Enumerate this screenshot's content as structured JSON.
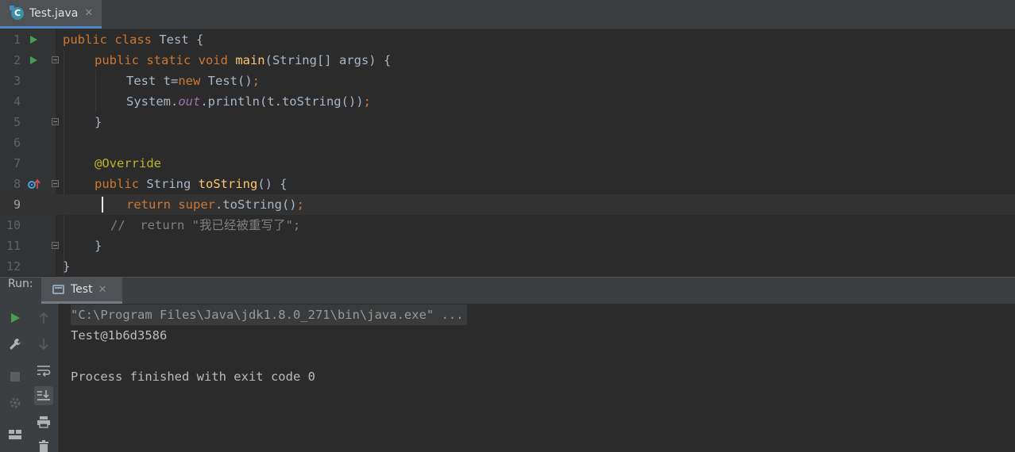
{
  "editor_tab": {
    "label": "Test.java",
    "close": "✕",
    "icon_letter": "C"
  },
  "code_lines": {
    "n1": "1",
    "n2": "2",
    "n3": "3",
    "n4": "4",
    "n5": "5",
    "n6": "6",
    "n7": "7",
    "n8": "8",
    "n9": "9",
    "n10": "10",
    "n11": "11",
    "n12": "12",
    "l1": {
      "kw": "public class ",
      "name": "Test",
      "rest": " {"
    },
    "l2": {
      "kw": "public static void ",
      "fn": "main",
      "rest": "(String[] args) {"
    },
    "l3": {
      "a": "Test t=",
      "kw": "new ",
      "b": "Test()",
      "semi": ";"
    },
    "l4": {
      "a": "System.",
      "fld": "out",
      "b": ".println(t.toString())",
      "semi": ";"
    },
    "l5": {
      "a": "}"
    },
    "l7": {
      "ann": "@Override"
    },
    "l8": {
      "kw": "public ",
      "a": "String ",
      "fn": "toString",
      "b": "() {"
    },
    "l9": {
      "kw": "return super",
      "b": ".toString()",
      "semi": ";"
    },
    "l10": {
      "cmt": "//  return \"我已经被重写了\";"
    },
    "l11": {
      "a": "}"
    },
    "l12": {
      "a": "}"
    }
  },
  "run_panel": {
    "title": "Run:",
    "tab_label": "Test",
    "tab_close": "✕",
    "console": {
      "command": "\"C:\\Program Files\\Java\\jdk1.8.0_271\\bin\\java.exe\" ...",
      "output": "Test@1b6d3586",
      "exit": "Process finished with exit code 0"
    }
  },
  "colors": {
    "keyword": "#cc7832",
    "function": "#ffc66d",
    "annotation": "#bbb529",
    "field": "#9876aa",
    "comment": "#808080",
    "text": "#a9b7c6",
    "run": "#499c54"
  }
}
